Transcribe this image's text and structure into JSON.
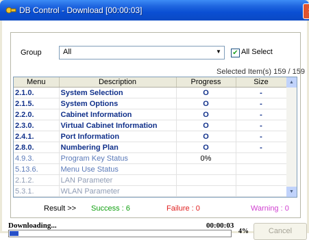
{
  "window": {
    "title": "DB Control - Download [00:00:03]"
  },
  "group": {
    "label": "Group",
    "value": "All",
    "all_select_label": "All Select",
    "all_select_checked": true
  },
  "selected_label": "Selected Item(s)  159 / 159",
  "table": {
    "columns": [
      "Menu",
      "Description",
      "Progress",
      "Size"
    ],
    "rows": [
      {
        "menu": "2.1.0.",
        "description": "System Selection",
        "progress": "O",
        "size": "-",
        "state": "done"
      },
      {
        "menu": "2.1.5.",
        "description": "System Options",
        "progress": "O",
        "size": "-",
        "state": "done"
      },
      {
        "menu": "2.2.0.",
        "description": "Cabinet Information",
        "progress": "O",
        "size": "-",
        "state": "done"
      },
      {
        "menu": "2.3.0.",
        "description": "Virtual Cabinet Information",
        "progress": "O",
        "size": "-",
        "state": "done"
      },
      {
        "menu": "2.4.1.",
        "description": "Port Information",
        "progress": "O",
        "size": "-",
        "state": "done"
      },
      {
        "menu": "2.8.0.",
        "description": "Numbering Plan",
        "progress": "O",
        "size": "-",
        "state": "done"
      },
      {
        "menu": "4.9.3.",
        "description": "Program Key Status",
        "progress": "0%",
        "size": "",
        "state": "pending"
      },
      {
        "menu": "5.13.6.",
        "description": "Menu Use Status",
        "progress": "",
        "size": "",
        "state": "pending"
      },
      {
        "menu": "2.1.2.",
        "description": "LAN Parameter",
        "progress": "",
        "size": "",
        "state": "idle"
      },
      {
        "menu": "5.3.1.",
        "description": "WLAN Parameter",
        "progress": "",
        "size": "",
        "state": "idle"
      }
    ]
  },
  "result": {
    "label": "Result >>",
    "success": "Success : 6",
    "failure": "Failure : 0",
    "warning": "Warning : 0"
  },
  "status": {
    "text": "Downloading...",
    "elapsed": "00:00:03",
    "percent_label": "4%",
    "percent": 4
  },
  "buttons": {
    "cancel": "Cancel"
  },
  "colors": {
    "title_bar": "#0a4fd3",
    "success": "#10a010",
    "failure": "#e02020",
    "warning": "#d040d0",
    "progress_fill": "#2750c8"
  }
}
